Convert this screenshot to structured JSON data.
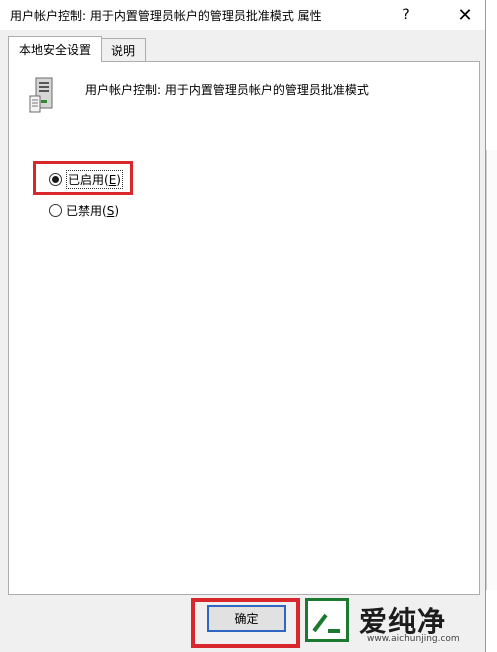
{
  "window": {
    "title": "用户帐户控制: 用于内置管理员帐户的管理员批准模式 属性",
    "help_label": "?",
    "close_label": "✕"
  },
  "tabs": [
    {
      "label": "本地安全设置",
      "active": true
    },
    {
      "label": "说明",
      "active": false
    }
  ],
  "policy": {
    "icon": "server-policy-icon",
    "name": "用户帐户控制: 用于内置管理员帐户的管理员批准模式"
  },
  "options": {
    "enabled": {
      "label": "已启用(",
      "key": "E",
      "suffix": ")",
      "selected": true
    },
    "disabled": {
      "label": "已禁用(",
      "key": "S",
      "suffix": ")",
      "selected": false
    }
  },
  "buttons": {
    "ok_label": "确定"
  },
  "highlight_color": "#d9272e",
  "watermark": {
    "text": "爱纯净",
    "url": "www.aichunjing.com",
    "color": "#1b7a2f"
  }
}
